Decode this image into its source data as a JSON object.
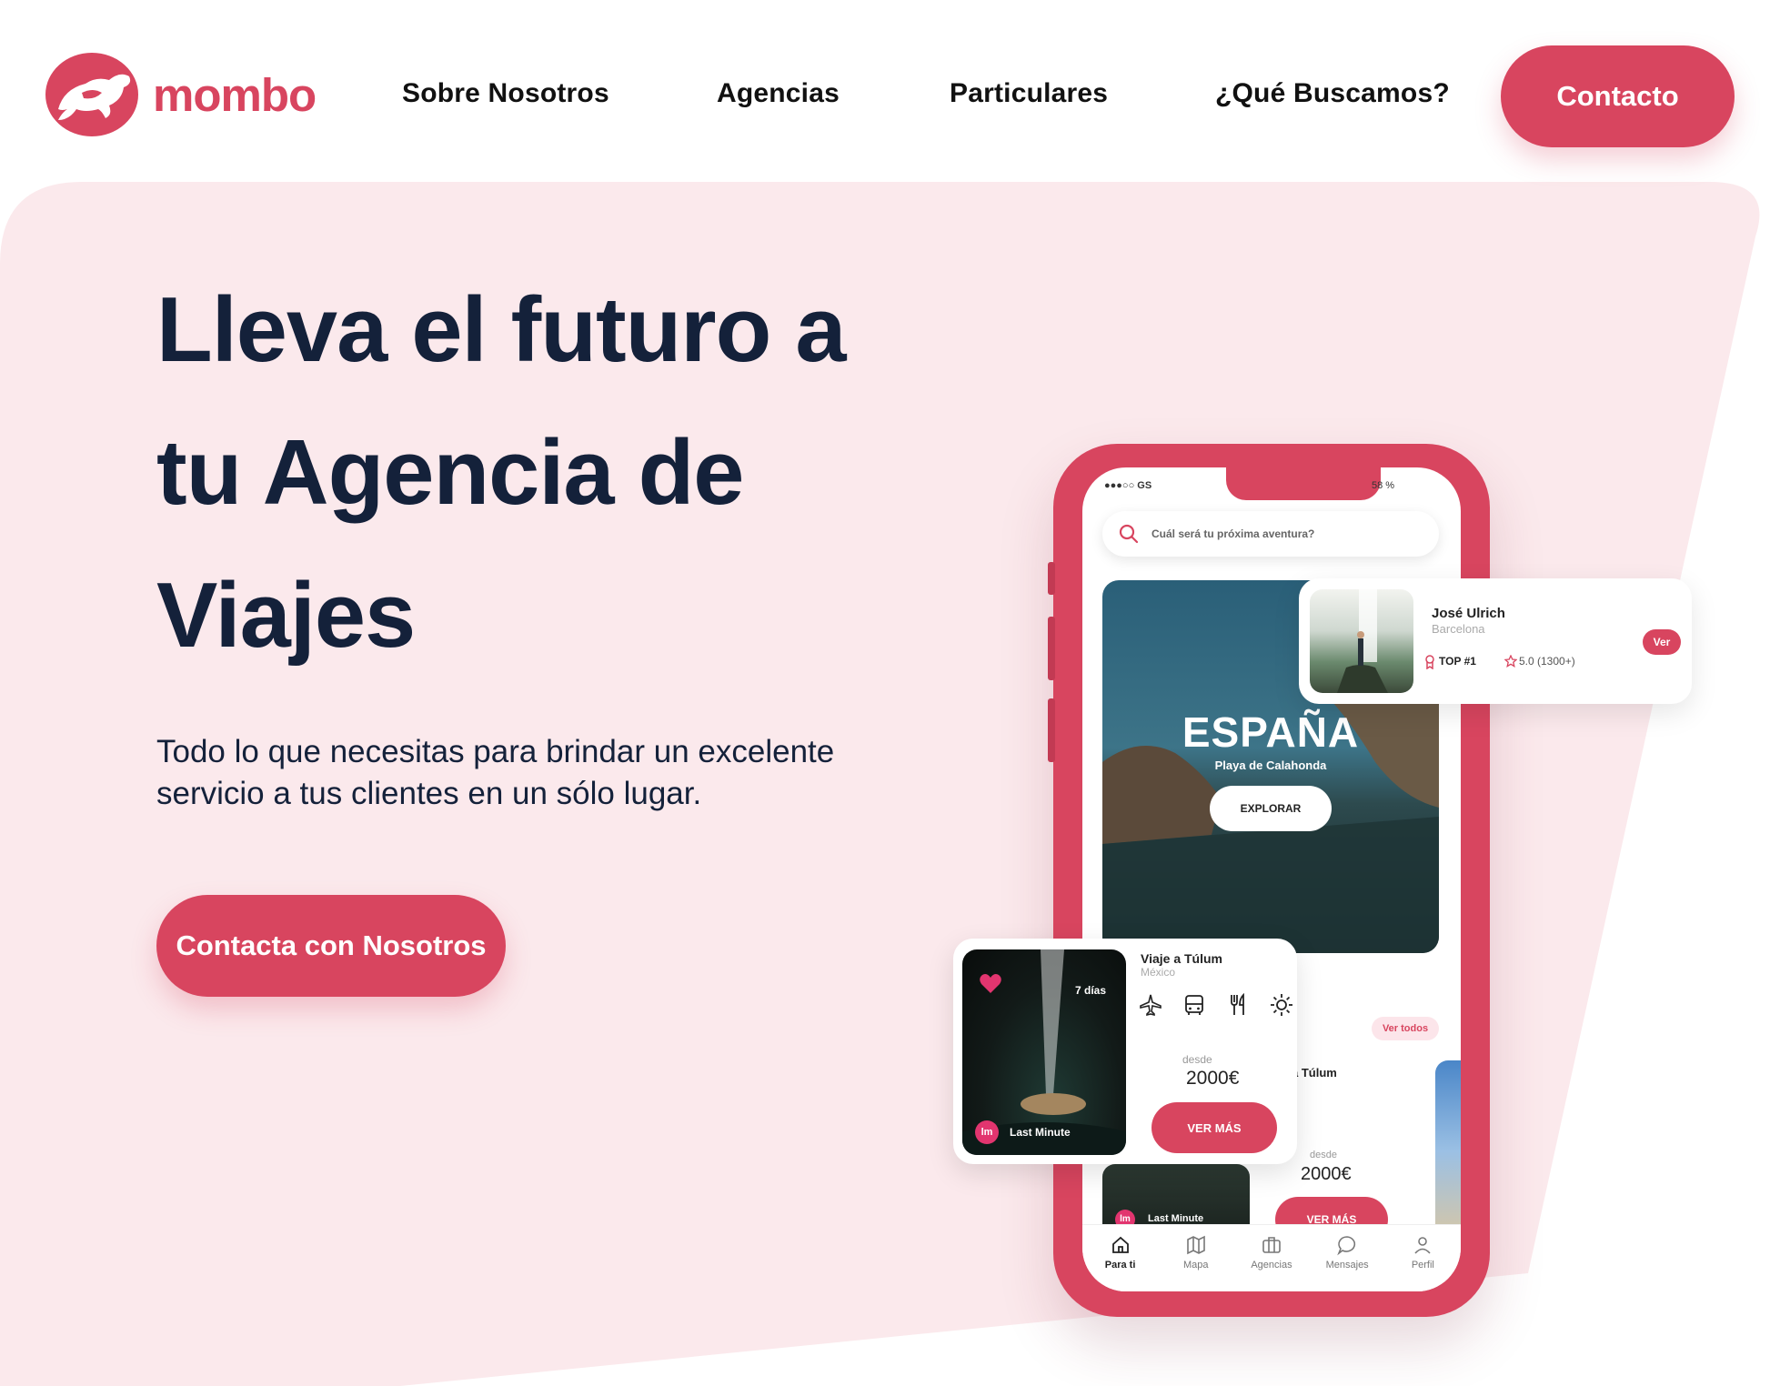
{
  "brand": {
    "name": "mombo",
    "accent_color": "#d8455f",
    "logo_icon": "turtle-icon"
  },
  "nav": {
    "items": [
      {
        "label": "Sobre Nosotros"
      },
      {
        "label": "Agencias"
      },
      {
        "label": "Particulares"
      },
      {
        "label": "¿Qué Buscamos?"
      }
    ],
    "contact_label": "Contacto"
  },
  "hero": {
    "title_lines": [
      "Lleva el futuro a",
      "tu Agencia de",
      "Viajes"
    ],
    "subtitle_lines": [
      "Todo lo que necesitas para brindar un excelente",
      "servicio a tus clientes en un sólo lugar."
    ],
    "cta_label": "Contacta con Nosotros",
    "background_color": "#fbe9ec"
  },
  "phone": {
    "status_left": "●●●○○ GS",
    "status_right": "58 %",
    "search_placeholder": "Cuál será tu próxima aventura?",
    "destination": {
      "name": "ESPAÑA",
      "subtitle": "Playa de Calahonda",
      "button_label": "EXPLORAR"
    },
    "see_all_label": "Ver todos",
    "background_trip": {
      "title": "a Túlum",
      "from_label": "desde",
      "price": "2000€",
      "button_label": "VER MÁS",
      "badge": "Last Minute",
      "badge_icon_text": "lm"
    },
    "tabs": [
      {
        "label": "Para ti",
        "icon": "home-icon",
        "active": true
      },
      {
        "label": "Mapa",
        "icon": "map-icon",
        "active": false
      },
      {
        "label": "Agencias",
        "icon": "briefcase-icon",
        "active": false
      },
      {
        "label": "Mensajes",
        "icon": "chat-icon",
        "active": false
      },
      {
        "label": "Perfil",
        "icon": "user-icon",
        "active": false
      }
    ]
  },
  "agent_card": {
    "name": "José Ulrich",
    "city": "Barcelona",
    "rank": "TOP #1",
    "rating": "5.0 (1300+)",
    "button_label": "Ver"
  },
  "trip_card": {
    "days": "7 días",
    "badge_icon_text": "lm",
    "badge": "Last Minute",
    "title": "Viaje a Túlum",
    "country": "México",
    "amenity_icons": [
      "plane-icon",
      "bus-icon",
      "cutlery-icon",
      "sun-icon"
    ],
    "from_label": "desde",
    "price": "2000€",
    "button_label": "VER MÁS"
  }
}
